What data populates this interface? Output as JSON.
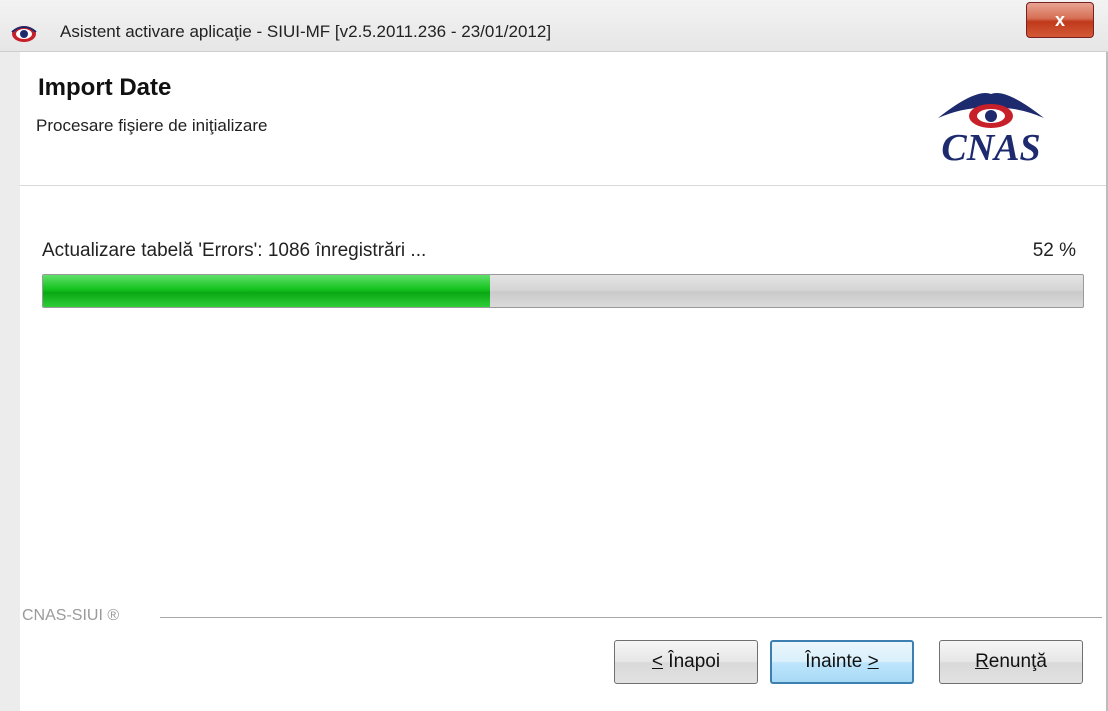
{
  "window": {
    "title": "Asistent activare aplicaţie - SIUI-MF [v2.5.2011.236 - 23/01/2012]",
    "close_label": "x"
  },
  "header": {
    "title": "Import Date",
    "subtitle": "Procesare fişiere de iniţializare",
    "logo_text": "CNAS"
  },
  "progress": {
    "label": "Actualizare tabelă 'Errors': 1086 înregistrări ...",
    "percent_text": "52 %",
    "percent": 0.43
  },
  "footer": {
    "brand": "CNAS-SIUI ®"
  },
  "buttons": {
    "back": {
      "accel": "<",
      "label": " Înapoi"
    },
    "next": {
      "label": "Înainte ",
      "accel": ">"
    },
    "cancel": {
      "accel": "R",
      "label": "enunţă"
    }
  },
  "colors": {
    "progress_fill": "#14c21e",
    "logo_blue": "#1d2a6e",
    "logo_red": "#c8202a"
  }
}
